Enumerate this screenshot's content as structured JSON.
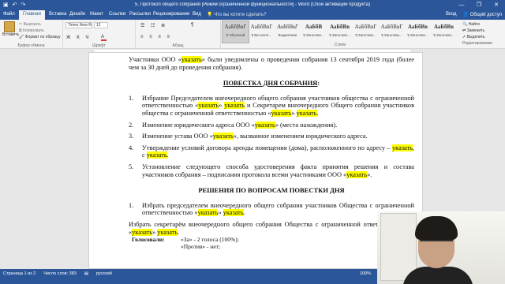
{
  "window": {
    "title": "5. Протокол общего собрания [Режим ограниченной функциональности] - Word (Сбой активации продукта)",
    "controls": [
      "—",
      "❐",
      "✕"
    ]
  },
  "tabs": [
    "Файл",
    "Главная",
    "Вставка",
    "Дизайн",
    "Макет",
    "Ссылки",
    "Рассылки",
    "Рецензирование",
    "Вид"
  ],
  "active_tab": "Главная",
  "tell_me": "Что вы хотите сделать?",
  "account": {
    "signin": "Вход",
    "share": "Общий доступ"
  },
  "ribbon": {
    "clipboard": {
      "paste": "Вставить",
      "cut": "Вырезать",
      "copy": "Копировать",
      "format_painter": "Формат по образцу",
      "label": "Буфер обмена"
    },
    "font": {
      "name": "Times New R",
      "size": "12",
      "format_buttons": "Ж К Ч",
      "label": "Шрифт"
    },
    "paragraph": {
      "label": "Абзац"
    },
    "styles": {
      "label": "Стили",
      "items": [
        {
          "sample": "АаБбВвГ",
          "name": "¶ Обычный"
        },
        {
          "sample": "АаБбВвГ",
          "name": "¶ Без инте..."
        },
        {
          "sample": "АаБбВвГ",
          "name": "Выделение"
        },
        {
          "sample": "АаБбВ",
          "name": "¶ Заголово..."
        },
        {
          "sample": "АаБбВв",
          "name": "¶ Заголово..."
        },
        {
          "sample": "АаБбВвГ",
          "name": "¶ Заголово..."
        },
        {
          "sample": "АаБбВвГ",
          "name": "¶ Заголово..."
        },
        {
          "sample": "АаБбВв",
          "name": "¶ Заголово..."
        },
        {
          "sample": "АаБбВв",
          "name": "¶ Заголово..."
        }
      ]
    },
    "editing": {
      "find": "Найти",
      "replace": "Заменить",
      "select": "Выделить",
      "label": "Редактирование"
    }
  },
  "document": {
    "intro": [
      "Участники ООО «",
      "указать",
      "» были уведомлены о проведении собрания 13 сентября 2019 года (более чем за 30 дней до проведения собрания)."
    ],
    "agenda_heading": "ПОВЕСТКА ДНЯ СОБРАНИЯ",
    "agenda_heading_colon": ":",
    "agenda": [
      {
        "num": "1.",
        "parts": [
          "Избрание Председателем внеочередного общего собрания участников общества с ограниченной ответственностью «",
          "указать",
          "» ",
          "указать",
          " и Секретарем внеочередного Общего собрания участников общества с ограниченной ответственностью «",
          "указать",
          "» ",
          "указать",
          "."
        ]
      },
      {
        "num": "2.",
        "parts": [
          "Изменение юридического адреса ООО «",
          "указать",
          "» (места нахождения)."
        ]
      },
      {
        "num": "3.",
        "parts": [
          "Изменение устава ООО «",
          "указать",
          "», вызванное изменением юридического адреса."
        ]
      },
      {
        "num": "4.",
        "parts": [
          "Утверждение условий договора аренды помещения (дома), расположенного по адресу – ",
          "указать",
          ", с ",
          "указать",
          "."
        ]
      },
      {
        "num": "5.",
        "parts": [
          "Установление следующего способа удостоверения факта принятия решения и состава участников собрания – подписания протокола всеми участниками ООО «",
          "указать",
          "»."
        ]
      }
    ],
    "decisions_heading": "РЕШЕНИЯ ПО ВОПРОСАМ ПОВЕСТКИ ДНЯ",
    "decisions": [
      {
        "num": "1.",
        "parts": [
          "Избрать председателем внеочередного общего собрания участников Общества с ограниченной ответственностью «",
          "указать",
          "» ",
          "указать",
          "."
        ]
      }
    ],
    "secretary": [
      "Избрать секретарём внеочередного общего собрания Общества с ограниченной ответственностью «",
      "указать",
      "» ",
      "указать",
      "."
    ],
    "votes_label": "Голосовали:",
    "votes": [
      "«За» - 2 голоса (100%);",
      "«Против» - нет;"
    ]
  },
  "statusbar": {
    "page": "Страница 1 из 2",
    "words": "Число слов: 383",
    "language": "русский",
    "zoom": "100%"
  },
  "colors": {
    "brand": "#2b579a",
    "highlight": "#ffff00"
  }
}
